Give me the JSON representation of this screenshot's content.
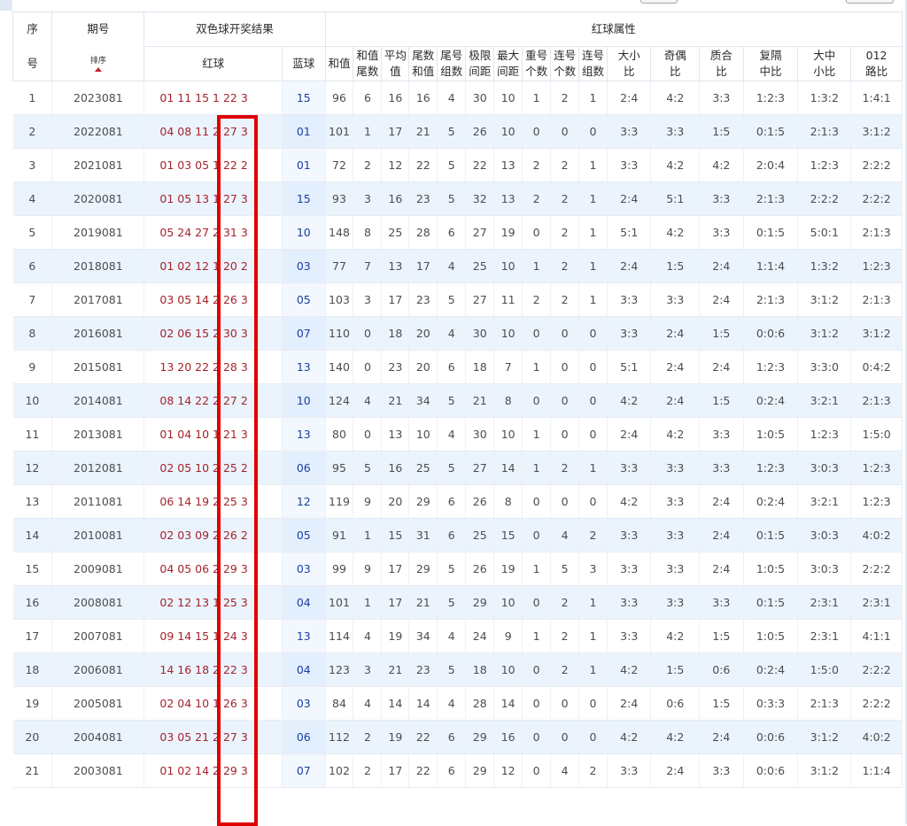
{
  "header": {
    "seq": "序号",
    "seq_top": "序",
    "seq_bot": "号",
    "issue": "期号",
    "sort_label": "排序",
    "draw_group": "双色球开奖结果",
    "attr_group": "红球属性",
    "red": "红球",
    "blue": "蓝球",
    "sum": "和值",
    "sum_tail_top": "和值",
    "sum_tail_bot": "尾数",
    "avg_top": "平均",
    "avg_bot": "值",
    "tail_sum_top": "尾数",
    "tail_sum_bot": "和值",
    "tail_groups_top": "尾号",
    "tail_groups_bot": "组数",
    "range_top": "极限",
    "range_bot": "间距",
    "max_gap_top": "最大",
    "max_gap_bot": "间距",
    "repeat_top": "重号",
    "repeat_bot": "个数",
    "consec_cnt_top": "连号",
    "consec_cnt_bot": "个数",
    "consec_grp_top": "连号",
    "consec_grp_bot": "组数",
    "bigsmall_top": "大小",
    "bigsmall_bot": "比",
    "oddeven_top": "奇偶",
    "oddeven_bot": "比",
    "primecomp_top": "质合",
    "primecomp_bot": "比",
    "triple_top": "复隔",
    "triple_bot": "中比",
    "bms_top": "大中",
    "bms_bot": "小比",
    "r012_top": "012",
    "r012_bot": "路比"
  },
  "rows": [
    {
      "seq": "1",
      "issue": "2023081",
      "red": "01 11 15 1  22 3",
      "blue": "15",
      "sum": "96",
      "sum_tail": "6",
      "avg": "16",
      "tail_sum": "16",
      "tail_groups": "4",
      "range": "30",
      "max_gap": "10",
      "repeat": "1",
      "consec_cnt": "2",
      "consec_grp": "1",
      "bigsmall": "2:4",
      "oddeven": "4:2",
      "primecomp": "3:3",
      "triple": "1:2:3",
      "bms": "1:3:2",
      "r012": "1:4:1"
    },
    {
      "seq": "2",
      "issue": "2022081",
      "red": "04 08 11 2  27 3",
      "blue": "01",
      "sum": "101",
      "sum_tail": "1",
      "avg": "17",
      "tail_sum": "21",
      "tail_groups": "5",
      "range": "26",
      "max_gap": "10",
      "repeat": "0",
      "consec_cnt": "0",
      "consec_grp": "0",
      "bigsmall": "3:3",
      "oddeven": "3:3",
      "primecomp": "1:5",
      "triple": "0:1:5",
      "bms": "2:1:3",
      "r012": "3:1:2"
    },
    {
      "seq": "3",
      "issue": "2021081",
      "red": "01 03 05 1  22 2",
      "blue": "01",
      "sum": "72",
      "sum_tail": "2",
      "avg": "12",
      "tail_sum": "22",
      "tail_groups": "5",
      "range": "22",
      "max_gap": "13",
      "repeat": "2",
      "consec_cnt": "2",
      "consec_grp": "1",
      "bigsmall": "3:3",
      "oddeven": "4:2",
      "primecomp": "4:2",
      "triple": "2:0:4",
      "bms": "1:2:3",
      "r012": "2:2:2"
    },
    {
      "seq": "4",
      "issue": "2020081",
      "red": "01 05 13 1  27 3",
      "blue": "15",
      "sum": "93",
      "sum_tail": "3",
      "avg": "16",
      "tail_sum": "23",
      "tail_groups": "5",
      "range": "32",
      "max_gap": "13",
      "repeat": "2",
      "consec_cnt": "2",
      "consec_grp": "1",
      "bigsmall": "2:4",
      "oddeven": "5:1",
      "primecomp": "3:3",
      "triple": "2:1:3",
      "bms": "2:2:2",
      "r012": "2:2:2"
    },
    {
      "seq": "5",
      "issue": "2019081",
      "red": "05 24 27 2  31 3",
      "blue": "10",
      "sum": "148",
      "sum_tail": "8",
      "avg": "25",
      "tail_sum": "28",
      "tail_groups": "6",
      "range": "27",
      "max_gap": "19",
      "repeat": "0",
      "consec_cnt": "2",
      "consec_grp": "1",
      "bigsmall": "5:1",
      "oddeven": "4:2",
      "primecomp": "3:3",
      "triple": "0:1:5",
      "bms": "5:0:1",
      "r012": "2:1:3"
    },
    {
      "seq": "6",
      "issue": "2018081",
      "red": "01 02 12 1  20 2",
      "blue": "03",
      "sum": "77",
      "sum_tail": "7",
      "avg": "13",
      "tail_sum": "17",
      "tail_groups": "4",
      "range": "25",
      "max_gap": "10",
      "repeat": "1",
      "consec_cnt": "2",
      "consec_grp": "1",
      "bigsmall": "2:4",
      "oddeven": "1:5",
      "primecomp": "2:4",
      "triple": "1:1:4",
      "bms": "1:3:2",
      "r012": "1:2:3"
    },
    {
      "seq": "7",
      "issue": "2017081",
      "red": "03 05 14 2  26 3",
      "blue": "05",
      "sum": "103",
      "sum_tail": "3",
      "avg": "17",
      "tail_sum": "23",
      "tail_groups": "5",
      "range": "27",
      "max_gap": "11",
      "repeat": "2",
      "consec_cnt": "2",
      "consec_grp": "1",
      "bigsmall": "3:3",
      "oddeven": "3:3",
      "primecomp": "2:4",
      "triple": "2:1:3",
      "bms": "3:1:2",
      "r012": "2:1:3"
    },
    {
      "seq": "8",
      "issue": "2016081",
      "red": "02 06 15 2  30 3",
      "blue": "07",
      "sum": "110",
      "sum_tail": "0",
      "avg": "18",
      "tail_sum": "20",
      "tail_groups": "4",
      "range": "30",
      "max_gap": "10",
      "repeat": "0",
      "consec_cnt": "0",
      "consec_grp": "0",
      "bigsmall": "3:3",
      "oddeven": "2:4",
      "primecomp": "1:5",
      "triple": "0:0:6",
      "bms": "3:1:2",
      "r012": "3:1:2"
    },
    {
      "seq": "9",
      "issue": "2015081",
      "red": "13 20 22 2  28 3",
      "blue": "13",
      "sum": "140",
      "sum_tail": "0",
      "avg": "23",
      "tail_sum": "20",
      "tail_groups": "6",
      "range": "18",
      "max_gap": "7",
      "repeat": "1",
      "consec_cnt": "0",
      "consec_grp": "0",
      "bigsmall": "5:1",
      "oddeven": "2:4",
      "primecomp": "2:4",
      "triple": "1:2:3",
      "bms": "3:3:0",
      "r012": "0:4:2"
    },
    {
      "seq": "10",
      "issue": "2014081",
      "red": "08 14 22 2  27 2",
      "blue": "10",
      "sum": "124",
      "sum_tail": "4",
      "avg": "21",
      "tail_sum": "34",
      "tail_groups": "5",
      "range": "21",
      "max_gap": "8",
      "repeat": "0",
      "consec_cnt": "0",
      "consec_grp": "0",
      "bigsmall": "4:2",
      "oddeven": "2:4",
      "primecomp": "1:5",
      "triple": "0:2:4",
      "bms": "3:2:1",
      "r012": "2:1:3"
    },
    {
      "seq": "11",
      "issue": "2013081",
      "red": "01 04 10 1  21 3",
      "blue": "13",
      "sum": "80",
      "sum_tail": "0",
      "avg": "13",
      "tail_sum": "10",
      "tail_groups": "4",
      "range": "30",
      "max_gap": "10",
      "repeat": "1",
      "consec_cnt": "0",
      "consec_grp": "0",
      "bigsmall": "2:4",
      "oddeven": "4:2",
      "primecomp": "3:3",
      "triple": "1:0:5",
      "bms": "1:2:3",
      "r012": "1:5:0"
    },
    {
      "seq": "12",
      "issue": "2012081",
      "red": "02 05 10 2  25 2",
      "blue": "06",
      "sum": "95",
      "sum_tail": "5",
      "avg": "16",
      "tail_sum": "25",
      "tail_groups": "5",
      "range": "27",
      "max_gap": "14",
      "repeat": "1",
      "consec_cnt": "2",
      "consec_grp": "1",
      "bigsmall": "3:3",
      "oddeven": "3:3",
      "primecomp": "3:3",
      "triple": "1:2:3",
      "bms": "3:0:3",
      "r012": "1:2:3"
    },
    {
      "seq": "13",
      "issue": "2011081",
      "red": "06 14 19 2  25 3",
      "blue": "12",
      "sum": "119",
      "sum_tail": "9",
      "avg": "20",
      "tail_sum": "29",
      "tail_groups": "6",
      "range": "26",
      "max_gap": "8",
      "repeat": "0",
      "consec_cnt": "0",
      "consec_grp": "0",
      "bigsmall": "4:2",
      "oddeven": "3:3",
      "primecomp": "2:4",
      "triple": "0:2:4",
      "bms": "3:2:1",
      "r012": "1:2:3"
    },
    {
      "seq": "14",
      "issue": "2010081",
      "red": "02 03 09 2  26 2",
      "blue": "05",
      "sum": "91",
      "sum_tail": "1",
      "avg": "15",
      "tail_sum": "31",
      "tail_groups": "6",
      "range": "25",
      "max_gap": "15",
      "repeat": "0",
      "consec_cnt": "4",
      "consec_grp": "2",
      "bigsmall": "3:3",
      "oddeven": "3:3",
      "primecomp": "2:4",
      "triple": "0:1:5",
      "bms": "3:0:3",
      "r012": "4:0:2"
    },
    {
      "seq": "15",
      "issue": "2009081",
      "red": "04 05 06 2  29 3",
      "blue": "03",
      "sum": "99",
      "sum_tail": "9",
      "avg": "17",
      "tail_sum": "29",
      "tail_groups": "5",
      "range": "26",
      "max_gap": "19",
      "repeat": "1",
      "consec_cnt": "5",
      "consec_grp": "3",
      "bigsmall": "3:3",
      "oddeven": "3:3",
      "primecomp": "2:4",
      "triple": "1:0:5",
      "bms": "3:0:3",
      "r012": "2:2:2"
    },
    {
      "seq": "16",
      "issue": "2008081",
      "red": "02 12 13 1  25 3",
      "blue": "04",
      "sum": "101",
      "sum_tail": "1",
      "avg": "17",
      "tail_sum": "21",
      "tail_groups": "5",
      "range": "29",
      "max_gap": "10",
      "repeat": "0",
      "consec_cnt": "2",
      "consec_grp": "1",
      "bigsmall": "3:3",
      "oddeven": "3:3",
      "primecomp": "3:3",
      "triple": "0:1:5",
      "bms": "2:3:1",
      "r012": "2:3:1"
    },
    {
      "seq": "17",
      "issue": "2007081",
      "red": "09 14 15 1  24 3",
      "blue": "13",
      "sum": "114",
      "sum_tail": "4",
      "avg": "19",
      "tail_sum": "34",
      "tail_groups": "4",
      "range": "24",
      "max_gap": "9",
      "repeat": "1",
      "consec_cnt": "2",
      "consec_grp": "1",
      "bigsmall": "3:3",
      "oddeven": "4:2",
      "primecomp": "1:5",
      "triple": "1:0:5",
      "bms": "2:3:1",
      "r012": "4:1:1"
    },
    {
      "seq": "18",
      "issue": "2006081",
      "red": "14 16 18 2  22 3",
      "blue": "04",
      "sum": "123",
      "sum_tail": "3",
      "avg": "21",
      "tail_sum": "23",
      "tail_groups": "5",
      "range": "18",
      "max_gap": "10",
      "repeat": "0",
      "consec_cnt": "2",
      "consec_grp": "1",
      "bigsmall": "4:2",
      "oddeven": "1:5",
      "primecomp": "0:6",
      "triple": "0:2:4",
      "bms": "1:5:0",
      "r012": "2:2:2"
    },
    {
      "seq": "19",
      "issue": "2005081",
      "red": "02 04 10 1  26 3",
      "blue": "03",
      "sum": "84",
      "sum_tail": "4",
      "avg": "14",
      "tail_sum": "14",
      "tail_groups": "4",
      "range": "28",
      "max_gap": "14",
      "repeat": "0",
      "consec_cnt": "0",
      "consec_grp": "0",
      "bigsmall": "2:4",
      "oddeven": "0:6",
      "primecomp": "1:5",
      "triple": "0:3:3",
      "bms": "2:1:3",
      "r012": "2:2:2"
    },
    {
      "seq": "20",
      "issue": "2004081",
      "red": "03 05 21 2  27 3",
      "blue": "06",
      "sum": "112",
      "sum_tail": "2",
      "avg": "19",
      "tail_sum": "22",
      "tail_groups": "6",
      "range": "29",
      "max_gap": "16",
      "repeat": "0",
      "consec_cnt": "0",
      "consec_grp": "0",
      "bigsmall": "4:2",
      "oddeven": "4:2",
      "primecomp": "2:4",
      "triple": "0:0:6",
      "bms": "3:1:2",
      "r012": "4:0:2"
    },
    {
      "seq": "21",
      "issue": "2003081",
      "red": "01 02 14 2  29 3",
      "blue": "07",
      "sum": "102",
      "sum_tail": "2",
      "avg": "17",
      "tail_sum": "22",
      "tail_groups": "6",
      "range": "29",
      "max_gap": "12",
      "repeat": "0",
      "consec_cnt": "4",
      "consec_grp": "2",
      "bigsmall": "3:3",
      "oddeven": "2:4",
      "primecomp": "3:3",
      "triple": "0:0:6",
      "bms": "3:1:2",
      "r012": "1:1:4"
    }
  ],
  "colors": {
    "red_ball": "#a6232b",
    "blue_ball": "#1a3fa6",
    "stripe": "#ebf4fd",
    "highlight_box": "#e00000",
    "sort_arrow": "#c0242a"
  },
  "icons": {
    "sort": "sort-up-arrow-icon"
  }
}
